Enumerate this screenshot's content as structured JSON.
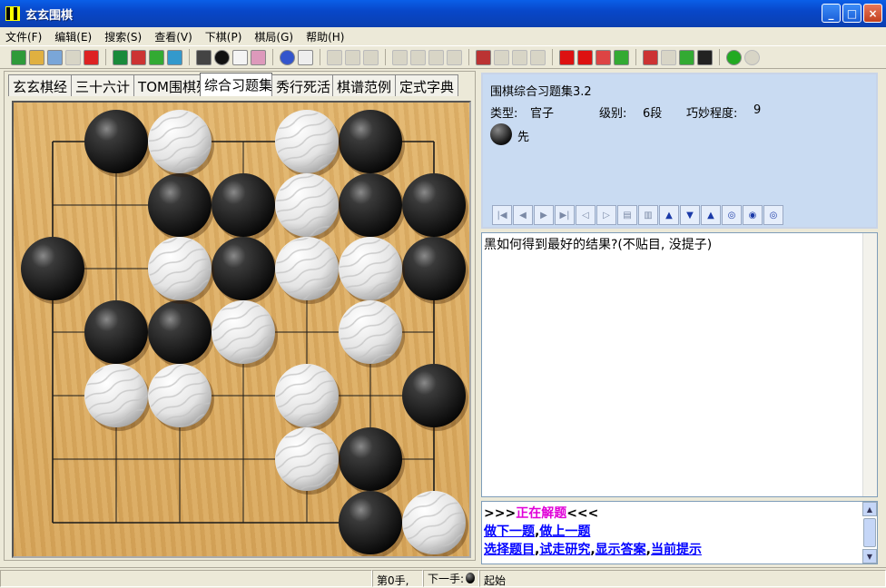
{
  "window": {
    "title": "玄玄围棋",
    "minimize": "_",
    "maximize": "□",
    "close": "×"
  },
  "menu": [
    "文件(F)",
    "编辑(E)",
    "搜索(S)",
    "查看(V)",
    "下棋(P)",
    "棋局(G)",
    "帮助(H)"
  ],
  "tabs": [
    "玄玄棋经",
    "三十六计",
    "TOM围棋殂",
    "综合习题集",
    "秀行死活",
    "棋谱范例",
    "定式字典"
  ],
  "active_tab_index": 3,
  "board": {
    "size": 7,
    "black": [
      [
        1,
        0
      ],
      [
        5,
        0
      ],
      [
        2,
        1
      ],
      [
        3,
        1
      ],
      [
        5,
        1
      ],
      [
        6,
        1
      ],
      [
        0,
        2
      ],
      [
        3,
        2
      ],
      [
        6,
        2
      ],
      [
        1,
        3
      ],
      [
        2,
        3
      ],
      [
        6,
        4
      ],
      [
        5,
        5
      ],
      [
        5,
        6
      ]
    ],
    "white": [
      [
        2,
        0
      ],
      [
        4,
        0
      ],
      [
        4,
        1
      ],
      [
        2,
        2
      ],
      [
        4,
        2
      ],
      [
        5,
        2
      ],
      [
        3,
        3
      ],
      [
        5,
        3
      ],
      [
        1,
        4
      ],
      [
        2,
        4
      ],
      [
        4,
        4
      ],
      [
        4,
        5
      ],
      [
        6,
        6
      ]
    ]
  },
  "problem": {
    "title": "围棋综合习题集3.2",
    "type_label": "类型:",
    "type": "官子",
    "level_label": "级别:",
    "level": "6段",
    "ingenuity_label": "巧妙程度:",
    "ingenuity": "9",
    "first_to_move": "先",
    "question": "黑如何得到最好的结果?(不贴目, 没提子)"
  },
  "solve_panel": {
    "prefix": ">>>",
    "status": "正在解题",
    "suffix": "<<<",
    "next_problem": "做下一题",
    "prev_problem": "做上一题",
    "select_problem": "选择题目",
    "try_research": "试走研究",
    "show_answer": "显示答案",
    "current_hint": "当前提示",
    "separator": ","
  },
  "statusbar": {
    "move": "第0手,",
    "next_label": "下一手:",
    "start": "起始"
  },
  "colors": {
    "board": "#dcac62",
    "link": "#0000ff",
    "status": "#e000d8",
    "panel": "#c9dbf2"
  }
}
